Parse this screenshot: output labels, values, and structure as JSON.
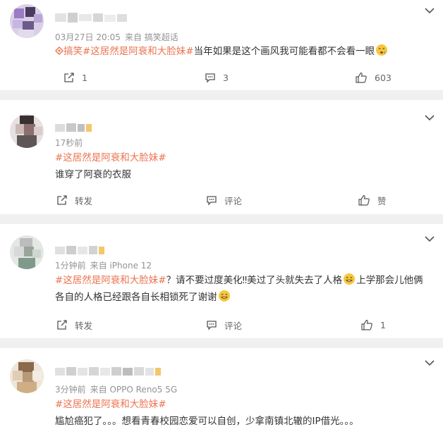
{
  "comments": [
    {
      "meta": "03月27日 20:05",
      "source": "来自 搞笑超话",
      "hot_tag": "搞笑",
      "topic": "#这居然是阿衰和大脸妹#",
      "text": "当年如果是这个画风我可能看都不会看一眼",
      "forward": "1",
      "comment": "3",
      "like": "603"
    },
    {
      "meta": "17秒前",
      "topic": "#这居然是阿衰和大脸妹#",
      "text": "谁穿了阿衰的衣服",
      "forward": "转发",
      "comment": "评论",
      "like": "赞"
    },
    {
      "meta": "1分钟前",
      "source": "来自 iPhone 12",
      "topic": "#这居然是阿衰和大脸妹#",
      "text_a": "？请不要过度美化‼美过了头就失去了人格",
      "text_b": "上学那会儿他俩",
      "text_c": "各自的人格已经跟各自长相锁死了谢谢",
      "forward": "转发",
      "comment": "评论",
      "like": "1"
    },
    {
      "meta": "3分钟前",
      "source": "来自 OPPO Reno5 5G",
      "topic": "#这居然是阿衰和大脸妹#",
      "text": "尴尬癌犯了。。。想看青春校园恋爱可以自创，少拿南镇北辙的IP借光。。。"
    }
  ]
}
